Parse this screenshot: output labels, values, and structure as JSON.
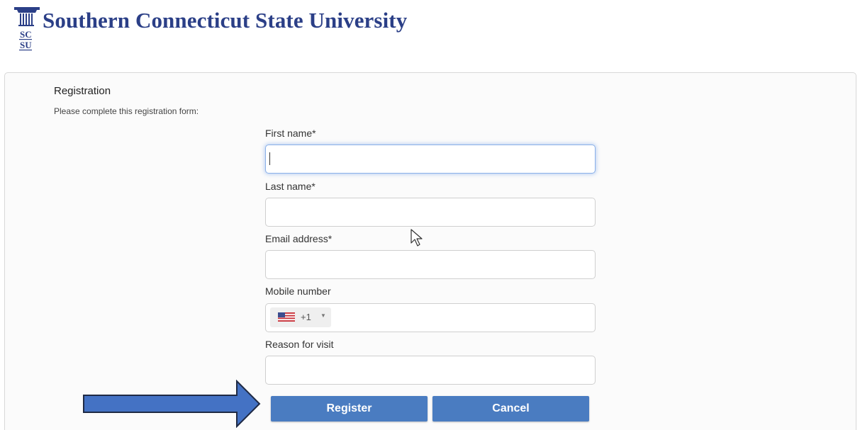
{
  "header": {
    "logo_letters": "SCSU",
    "university_name": "Southern Connecticut State University"
  },
  "registration": {
    "title": "Registration",
    "subtitle": "Please complete this registration form:",
    "fields": {
      "first_name": {
        "label": "First name*",
        "value": ""
      },
      "last_name": {
        "label": "Last name*",
        "value": ""
      },
      "email": {
        "label": "Email address*",
        "value": ""
      },
      "mobile": {
        "label": "Mobile number",
        "value": "",
        "country_flag": "us-flag-icon",
        "dial_code": "+1"
      },
      "reason": {
        "label": "Reason for visit",
        "value": ""
      }
    },
    "buttons": {
      "register": "Register",
      "cancel": "Cancel"
    }
  },
  "colors": {
    "brand_navy": "#2b3f87",
    "button_blue": "#4a7cc1",
    "annotation_arrow": "#4472c4"
  },
  "annotations": {
    "arrow_icon": "right-arrow-annotation-icon",
    "cursor_icon": "mouse-pointer-icon"
  }
}
